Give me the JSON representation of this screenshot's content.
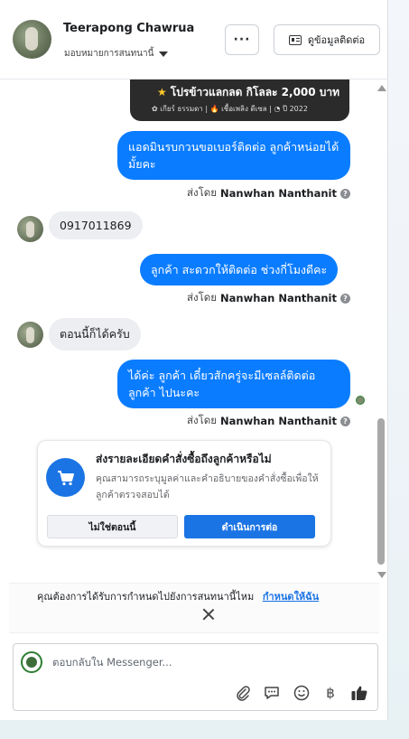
{
  "header": {
    "contact_name": "Teerapong Chawrua",
    "assign_label": "มอบหมายการสนทนานี้",
    "more_label": "···",
    "contact_info_label": "ดูข้อมูลติดต่อ"
  },
  "promo": {
    "line1": "โปรข้าวแลกลด กิโลละ 2,000 บาท",
    "line2": "✿ เกียร์ ธรรมดา  |  🔥 เชื้อเพลิง ดีเซล  |  ◔ ปี 2022"
  },
  "messages": [
    {
      "direction": "out",
      "text": "แอดมินรบกวนขอเบอร์ติดต่อ ลูกค้าหน่อยได้มั้ยคะ",
      "sent_by": "Nanwhan Nanthanit"
    },
    {
      "direction": "in",
      "text": "0917011869"
    },
    {
      "direction": "out",
      "text": "ลูกค้า สะดวกให้ติดต่อ ช่วงกี่โมงดีคะ",
      "sent_by": "Nanwhan Nanthanit"
    },
    {
      "direction": "in",
      "text": "ตอนนี้ก็ได้ครับ"
    },
    {
      "direction": "out",
      "text": "ได้ค่ะ ลูกค้า เดี๋ยวสักครู่จะมีเซลล์ติดต่อลูกค้า ไปนะคะ",
      "sent_by": "Nanwhan Nanthanit"
    }
  ],
  "sent_by_prefix": "ส่งโดย",
  "order_card": {
    "title": "ส่งรายละเอียดคำสั่งซื้อถึงลูกค้าหรือไม่",
    "description": "คุณสามารถระบุมูลค่าและคำอธิบายของคำสั่งซื้อเพื่อให้ลูกค้าตรวจสอบได้",
    "no_label": "ไม่ใช่ตอนนี้",
    "continue_label": "ดำเนินการต่อ"
  },
  "assign_prompt": {
    "text": "คุณต้องการได้รับการกำหนดไปยังการสนทนานี้ไหม",
    "link": "กำหนดให้ฉัน"
  },
  "composer": {
    "placeholder": "ตอบกลับใน Messenger...",
    "tools": [
      "paperclip-icon",
      "speech-bubble-icon",
      "emoji-icon",
      "baht-icon",
      "thumbs-up-icon"
    ]
  },
  "colors": {
    "accent": "#1b74e4",
    "bubble_out": "#0a7cff",
    "bubble_in": "#eceef1"
  }
}
